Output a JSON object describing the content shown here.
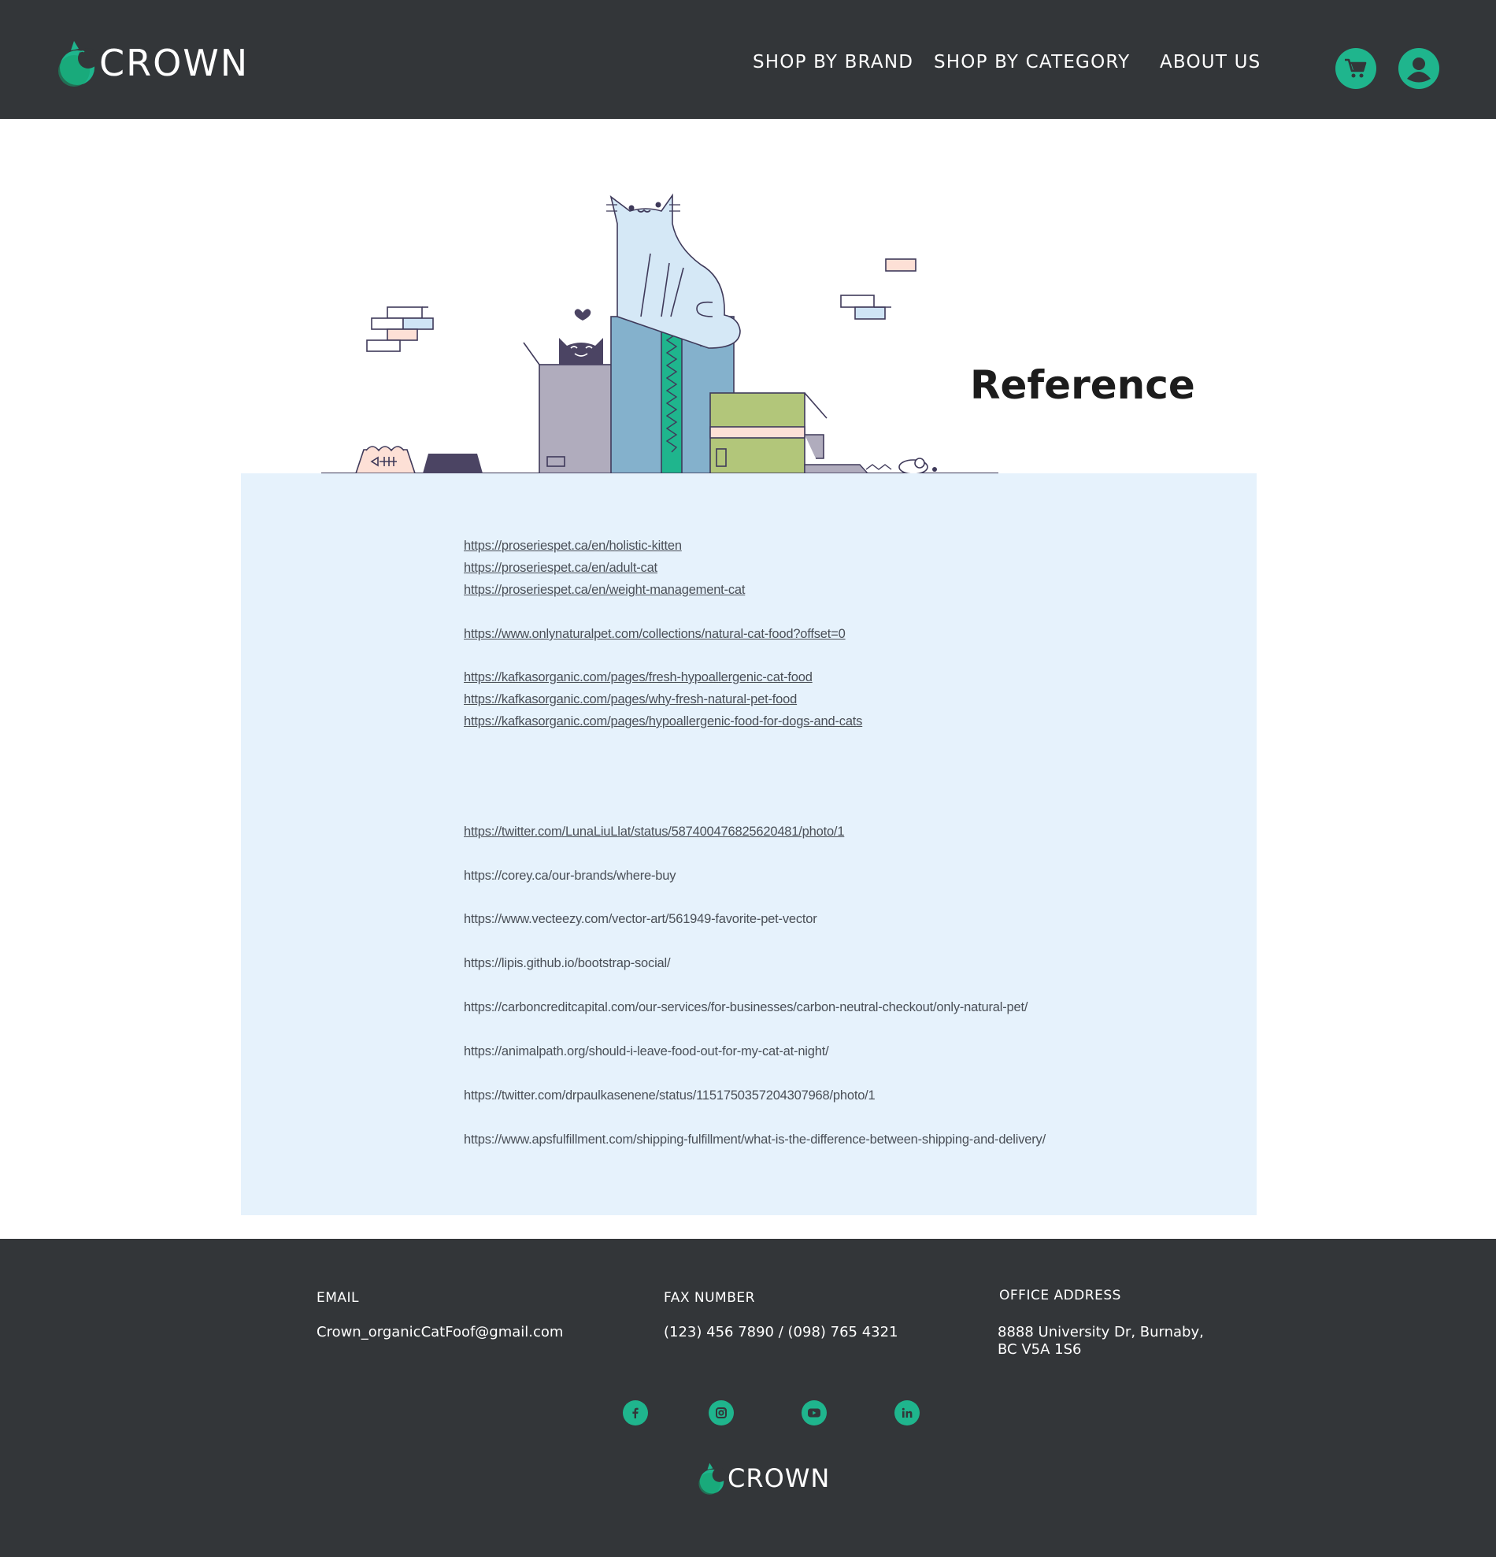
{
  "brand": {
    "name": "CROWN",
    "accent_color": "#1fb58d",
    "dark_color": "#333639",
    "panel_color": "#e6f2fc"
  },
  "nav": {
    "items": [
      {
        "label": "SHOP BY BRAND"
      },
      {
        "label": "SHOP BY CATEGORY"
      },
      {
        "label": "ABOUT US"
      }
    ],
    "icons": [
      "cart-icon",
      "user-icon"
    ]
  },
  "hero": {
    "title": "Reference",
    "illustration": "cats-with-boxes-illustration"
  },
  "references": [
    {
      "text": "https://proseriespet.ca/en/holistic-kitten",
      "underlined": true
    },
    {
      "text": "https://proseriespet.ca/en/adult-cat",
      "underlined": true
    },
    {
      "text": "https://proseriespet.ca/en/weight-management-cat",
      "underlined": true
    },
    {
      "text": "https://www.onlynaturalpet.com/collections/natural-cat-food?offset=0",
      "underlined": true
    },
    {
      "text": "https://kafkasorganic.com/pages/fresh-hypoallergenic-cat-food",
      "underlined": true
    },
    {
      "text": "https://kafkasorganic.com/pages/why-fresh-natural-pet-food",
      "underlined": true
    },
    {
      "text": "https://kafkasorganic.com/pages/hypoallergenic-food-for-dogs-and-cats",
      "underlined": true
    },
    {
      "text": "https://twitter.com/LunaLiuLlat/status/587400476825620481/photo/1",
      "underlined": true
    },
    {
      "text": "https://corey.ca/our-brands/where-buy",
      "underlined": false
    },
    {
      "text": "https://www.vecteezy.com/vector-art/561949-favorite-pet-vector",
      "underlined": false
    },
    {
      "text": "https://lipis.github.io/bootstrap-social/",
      "underlined": false
    },
    {
      "text": "https://carboncreditcapital.com/our-services/for-businesses/carbon-neutral-checkout/only-natural-pet/",
      "underlined": false
    },
    {
      "text": "https://animalpath.org/should-i-leave-food-out-for-my-cat-at-night/",
      "underlined": false
    },
    {
      "text": "https://twitter.com/drpaulkasenene/status/1151750357204307968/photo/1",
      "underlined": false
    },
    {
      "text": "https://www.apsfulfillment.com/shipping-fulfillment/what-is-the-difference-between-shipping-and-delivery/",
      "underlined": false
    }
  ],
  "footer": {
    "email_label": "EMAIL",
    "email_value": "Crown_organicCatFoof@gmail.com",
    "fax_label": "FAX NUMBER",
    "fax_value": "(123) 456 7890 / (098) 765 4321",
    "address_label": "OFFICE ADDRESS",
    "address_line1": "8888 University Dr, Burnaby,",
    "address_line2": "BC V5A 1S6",
    "social_icons": [
      "facebook-icon",
      "instagram-icon",
      "youtube-icon",
      "linkedin-icon"
    ],
    "brand_name": "CROWN"
  }
}
